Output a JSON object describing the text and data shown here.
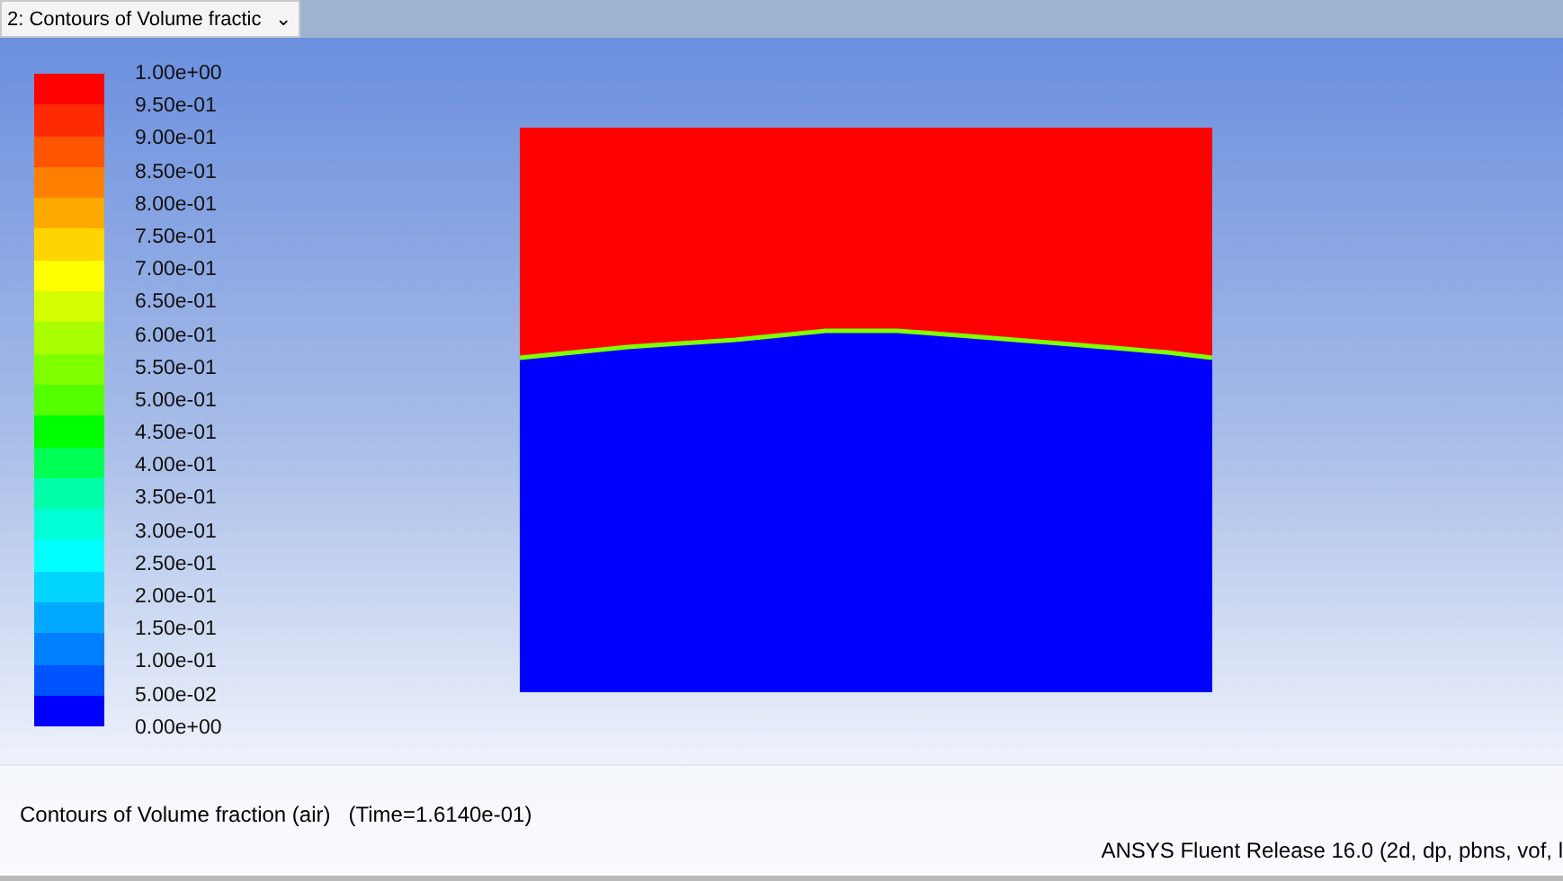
{
  "view_selector": {
    "value": "2: Contours of Volume fractic",
    "caret": "⌄"
  },
  "legend": {
    "bands": [
      {
        "color": "#ff0000"
      },
      {
        "color": "#ff2a00"
      },
      {
        "color": "#ff5400"
      },
      {
        "color": "#ff7f00"
      },
      {
        "color": "#ffa900"
      },
      {
        "color": "#ffd400"
      },
      {
        "color": "#ffff00"
      },
      {
        "color": "#d4ff00"
      },
      {
        "color": "#a9ff00"
      },
      {
        "color": "#7fff00"
      },
      {
        "color": "#54ff00"
      },
      {
        "color": "#00ff00"
      },
      {
        "color": "#00ff54"
      },
      {
        "color": "#00ffa9"
      },
      {
        "color": "#00ffd4"
      },
      {
        "color": "#00ffff"
      },
      {
        "color": "#00d4ff"
      },
      {
        "color": "#00a9ff"
      },
      {
        "color": "#007fff"
      },
      {
        "color": "#0054ff"
      },
      {
        "color": "#0000ff"
      }
    ],
    "labels": [
      "1.00e+00",
      "9.50e-01",
      "9.00e-01",
      "8.50e-01",
      "8.00e-01",
      "7.50e-01",
      "7.00e-01",
      "6.50e-01",
      "6.00e-01",
      "5.50e-01",
      "5.00e-01",
      "4.50e-01",
      "4.00e-01",
      "3.50e-01",
      "3.00e-01",
      "2.50e-01",
      "2.00e-01",
      "1.50e-01",
      "1.00e-01",
      "5.00e-02",
      "0.00e+00"
    ]
  },
  "plot_title": "Contours of Volume fraction (air)   (Time=1.6140e-01)",
  "release_info": "ANSYS Fluent Release 16.0 (2d, dp, pbns, vof, l"
}
